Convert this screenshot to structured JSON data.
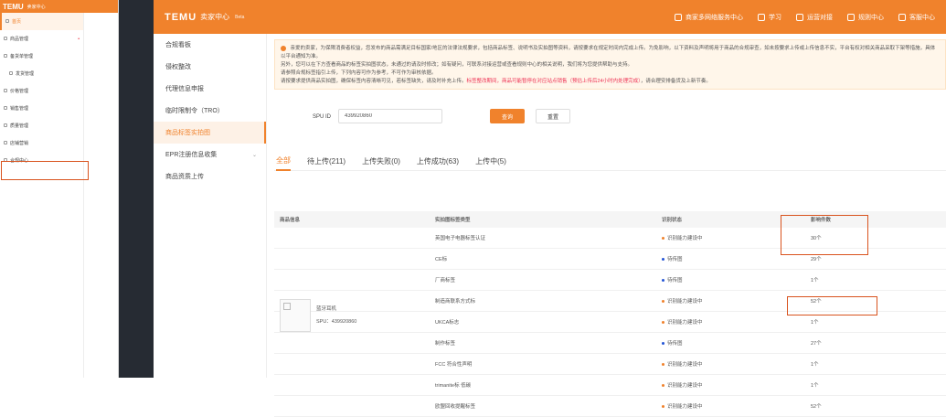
{
  "bg_window": {
    "brand": "TEMU",
    "brand_sub": "卖家中心",
    "items": [
      {
        "label": "首页",
        "active": true
      },
      {
        "label": "商品管理",
        "dot": "•"
      },
      {
        "label": "备货单管理"
      },
      {
        "label": "发货管理",
        "sub": true
      },
      {
        "label": "价格管理"
      },
      {
        "label": "销售管理"
      },
      {
        "label": "质量管理"
      },
      {
        "label": "店铺营销"
      },
      {
        "label": "合规中心"
      }
    ]
  },
  "topbar": {
    "brand": "TEMU",
    "brand_sub": "卖家中心",
    "beta": "Beta",
    "links": [
      "商家多网络服务中心",
      "学习",
      "运营对接",
      "规则中心",
      "客服中心"
    ]
  },
  "sidebar": {
    "items": [
      {
        "label": "合规看板"
      },
      {
        "label": "侵权整改"
      },
      {
        "label": "代理信息申报"
      },
      {
        "label": "临时限制令（TRO）"
      },
      {
        "label": "商品标签实拍图",
        "active": true
      },
      {
        "label": "EPR注册信息收集",
        "chev": "⌄"
      },
      {
        "label": "商品资质上传"
      }
    ]
  },
  "notice": {
    "line1": "亲爱的卖家，为保障消费者权益，您发布的商品需满足目标国家/地区的法律法规要求，包括商品标签、说明书及实拍图等资料，请按要求在规定时间内完成上传。为免影响，以下资料及声明将用于商品的合规审查，如未按要求上传或上传信息不实，平台有权对相关商品采取下架等措施，具体以平台通知为准。",
    "line2": "另外，您可以在下方查看商品的标签实拍图状态，未通过的请及时修改；如有疑问，可联系对接运营或查看规则中心的相关说明，我们将为您提供帮助与支持。",
    "line3": "请参照合规标签指引上传，下列内容可作为参考，不可作为审核依据。",
    "line4_a": "请按要求提供商品实拍图，确保标签内容清晰可见，若标签缺失，请及时补充上传。",
    "line4_red": "标签整改期间，商品可能暂停在对应站点销售（预估上传后24小时内处理完成）",
    "line4_b": "，请合理安排备货及上新节奏。"
  },
  "search": {
    "spu_label": "SPU ID",
    "spu_value": "439920860",
    "query_label": "查询",
    "reset_label": "重置"
  },
  "tabs": [
    {
      "label": "全部",
      "active": true
    },
    {
      "label": "待上传(211)"
    },
    {
      "label": "上传失败(0)"
    },
    {
      "label": "上传成功(63)"
    },
    {
      "label": "上传中(5)"
    }
  ],
  "table": {
    "headers": {
      "info": "商品信息",
      "type": "实拍图标签类型",
      "state": "识别状态",
      "count": "影响件数"
    },
    "product": {
      "name": "蓝牙耳机",
      "spu": "SPU：439920860"
    },
    "rows": [
      {
        "type": "英国电子电器标签认证",
        "state": "识别能力建设中",
        "status": "warn",
        "count": "30个"
      },
      {
        "type": "CE标",
        "state": "待传图",
        "status": "ok",
        "count": "29个"
      },
      {
        "type": "厂商标签",
        "state": "待传图",
        "status": "ok",
        "count": "1个"
      },
      {
        "type": "制造商联系方式标",
        "state": "识别能力建设中",
        "status": "warn",
        "count": "52个"
      },
      {
        "type": "UKCA标志",
        "state": "识别能力建设中",
        "status": "warn",
        "count": "1个"
      },
      {
        "type": "制作标签",
        "state": "待传图",
        "status": "ok",
        "count": "27个"
      },
      {
        "type": "FCC 符合性声明",
        "state": "识别能力建设中",
        "status": "warn",
        "count": "1个"
      },
      {
        "type": "trimanite标 低碳",
        "state": "识别能力建设中",
        "status": "warn",
        "count": "1个"
      },
      {
        "type": "欧盟回收提醒标签",
        "state": "识别能力建设中",
        "status": "warn",
        "count": "52个"
      }
    ]
  },
  "colors": {
    "brand": "#f0822c",
    "highlight": "#d9531e",
    "ok_dot": "#2455d6"
  }
}
